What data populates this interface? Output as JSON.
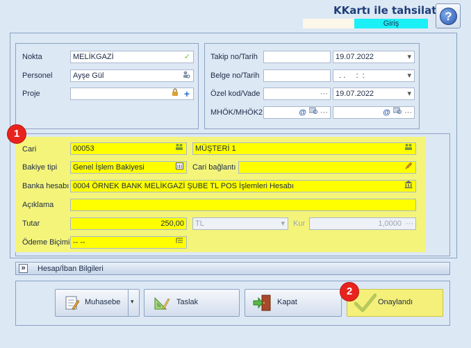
{
  "header": {
    "title": "KKartı ile tahsilat",
    "subtitle": "Giriş",
    "help_icon": "?"
  },
  "left_top": {
    "nokta": {
      "label": "Nokta",
      "value": "MELİKGAZİ"
    },
    "personel": {
      "label": "Personel",
      "value": "Ayşe Gül"
    },
    "proje": {
      "label": "Proje",
      "value": ""
    }
  },
  "right_top": {
    "takip": {
      "label": "Takip no/Tarih",
      "value": "",
      "date": "19.07.2022"
    },
    "belge": {
      "label": "Belge no/Tarih",
      "value": "",
      "datetime": ". .     :  :"
    },
    "ozel": {
      "label": "Özel kod/Vade",
      "value": "",
      "date": "19.07.2022"
    },
    "mhok": {
      "label": "MHÖK/MHÖK2"
    }
  },
  "details": {
    "cari": {
      "label": "Cari",
      "code": "00053",
      "name": "MÜŞTERİ 1"
    },
    "bakiye": {
      "label": "Bakiye tipi",
      "value": "Genel İşlem Bakiyesi"
    },
    "cari_baglanti": {
      "label": "Cari bağlantı",
      "value": ""
    },
    "banka": {
      "label": "Banka hesabı",
      "value": "0004 ÖRNEK BANK MELİKGAZİ ŞUBE TL POS İşlemleri Hesabı"
    },
    "aciklama": {
      "label": "Açıklama",
      "value": ""
    },
    "tutar": {
      "label": "Tutar",
      "value": "250,00",
      "currency": "TL"
    },
    "kur": {
      "label": "Kur",
      "value": "1,0000"
    },
    "odeme": {
      "label": "Ödeme Biçimi",
      "value": "-- --"
    }
  },
  "collapse": {
    "icon": "»",
    "label": "Hesap/İban Bilgileri"
  },
  "buttons": {
    "muhasebe": "Muhasebe",
    "taslak": "Taslak",
    "kapat": "Kapat",
    "onaylandi": "Onaylandı"
  },
  "badges": {
    "one": "1",
    "two": "2"
  },
  "icons": {
    "ellipsis": "···",
    "dropdown": "▾",
    "check": "✓",
    "plus": "+",
    "at": "@"
  },
  "colors": {
    "highlight": "#ffff00",
    "badge": "#e8231e",
    "subtitle_bg": "#1af0f5"
  }
}
